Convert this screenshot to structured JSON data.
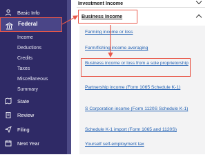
{
  "sidebar": {
    "items": [
      {
        "label": "Basic Info",
        "icon": "person-icon"
      },
      {
        "label": "Federal",
        "icon": "bank-icon"
      },
      {
        "label": "State",
        "icon": "map-icon"
      },
      {
        "label": "Review",
        "icon": "clipboard-icon"
      },
      {
        "label": "Filing",
        "icon": "paper-plane-icon"
      },
      {
        "label": "Next Year",
        "icon": "calendar-icon"
      }
    ],
    "federal_sub": [
      "Income",
      "Deductions",
      "Credits",
      "Taxes",
      "Miscellaneous",
      "Summary"
    ]
  },
  "main": {
    "investment_income": "Investment Income",
    "business_income": "Business Income",
    "links": [
      "Farming income or loss",
      "Farm/fishing income averaging",
      "Business income or loss from a sole proprietorship",
      "Partnership income (Form 1065 Schedule K-1)",
      "S Corporation income (Form 1120S Schedule K-1)",
      "Schedule K-1 import (Form 1065 and 1120S)",
      "Yourself self-employment tax"
    ]
  },
  "colors": {
    "sidebar_bg": "#2f2a66",
    "highlight": "#e8584a",
    "link": "#1f5fb2"
  }
}
